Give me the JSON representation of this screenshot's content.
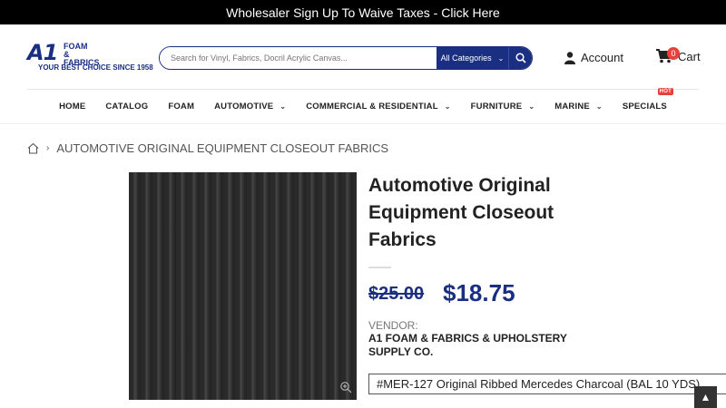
{
  "topbar": {
    "text": "Wholesaler Sign Up To Waive Taxes - Click Here"
  },
  "logo": {
    "mark": "A1",
    "brand": "FOAM & FABRICS",
    "tagline": "YOUR BEST CHOICE SINCE 1958"
  },
  "search": {
    "placeholder": "Search for Vinyl, Fabrics, Docril Acrylic Canvas...",
    "category": "All Categories"
  },
  "header": {
    "account_label": "Account",
    "cart_label": "Cart",
    "cart_count": "0"
  },
  "nav": {
    "items": [
      {
        "label": "HOME"
      },
      {
        "label": "CATALOG"
      },
      {
        "label": "FOAM"
      },
      {
        "label": "AUTOMOTIVE"
      },
      {
        "label": "COMMERCIAL & RESIDENTIAL"
      },
      {
        "label": "FURNITURE"
      },
      {
        "label": "MARINE"
      },
      {
        "label": "SPECIALS",
        "badge": "HOT"
      }
    ]
  },
  "breadcrumb": {
    "current": "AUTOMOTIVE ORIGINAL EQUIPMENT CLOSEOUT FABRICS"
  },
  "product": {
    "title": "Automotive Original Equipment Closeout Fabrics",
    "old_price": "$25.00",
    "price": "$18.75",
    "vendor_label": "VENDOR:",
    "vendor": "A1 FOAM & FABRICS & UPHOLSTERY SUPPLY CO.",
    "variant": "#MER-127 Original Ribbed Mercedes Charcoal (BAL 10 YDS)"
  },
  "colors": {
    "brand": "#1b2f82",
    "badge": "#e8413b"
  }
}
